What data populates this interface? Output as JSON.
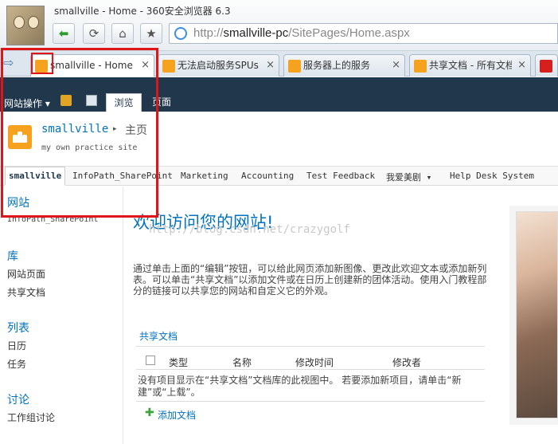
{
  "window": {
    "title": "smallville - Home - 360安全浏览器 6.3"
  },
  "toolbar": {
    "back": "back-button",
    "refresh": "refresh-button",
    "home": "home-button",
    "favorite": "favorite-button"
  },
  "address": {
    "url_prefix": "http://",
    "url_host": "smallville-pc",
    "url_path": "/SitePages/Home.aspx"
  },
  "tabs": [
    {
      "label": "smallville - Home",
      "active": true,
      "close": "×"
    },
    {
      "label": "无法启动服务SPUs",
      "active": false,
      "close": "×"
    },
    {
      "label": "服务器上的服务",
      "active": false,
      "close": "×"
    },
    {
      "label": "共享文档 - 所有文档",
      "active": false,
      "close": "×"
    }
  ],
  "ribbon": {
    "site_actions": "网站操作 ▾",
    "tab_browse": "浏览",
    "tab_page": "页面"
  },
  "site": {
    "name": "smallville",
    "crumb_arrow": "▸",
    "page": "主页",
    "description": "my own practice site"
  },
  "topnav": {
    "items": [
      "smallville",
      "InfoPath_SharePoint",
      "Marketing",
      "Accounting",
      "Test Feedback",
      "我爱美剧 ▾",
      "Help Desk System"
    ]
  },
  "leftnav": {
    "sites_heading": "网站",
    "sites_sub": "InfoPath_SharePoint",
    "libraries_heading": "库",
    "libraries": [
      "网站页面",
      "共享文档"
    ],
    "lists_heading": "列表",
    "lists": [
      "日历",
      "任务"
    ],
    "discussions_heading": "讨论",
    "discussions": [
      "工作组讨论"
    ]
  },
  "main": {
    "title": "欢迎访问您的网站!",
    "watermark": "http://blog.csdn.net/crazygolf",
    "intro": "通过单击上面的“编辑”按钮，可以给此网页添加新图像、更改此欢迎文本或添加新列表。可以单击“共享文档”以添加文件或在日历上创建新的团体活动。使用入门教程部分的链接可以共享您的网站和自定义它的外观。",
    "library_title": "共享文档",
    "columns": [
      "类型",
      "名称",
      "修改时间",
      "修改者"
    ],
    "empty_message": "没有项目显示在“共享文档”文档库的此视图中。 若要添加新项目，请单击“新建”或“上载”。",
    "add_doc": "添加文档"
  },
  "colors": {
    "accent": "#0072bc",
    "ribbon": "#21374c",
    "highlight": "#e0151a",
    "tab_icon": "#f6a21e"
  }
}
